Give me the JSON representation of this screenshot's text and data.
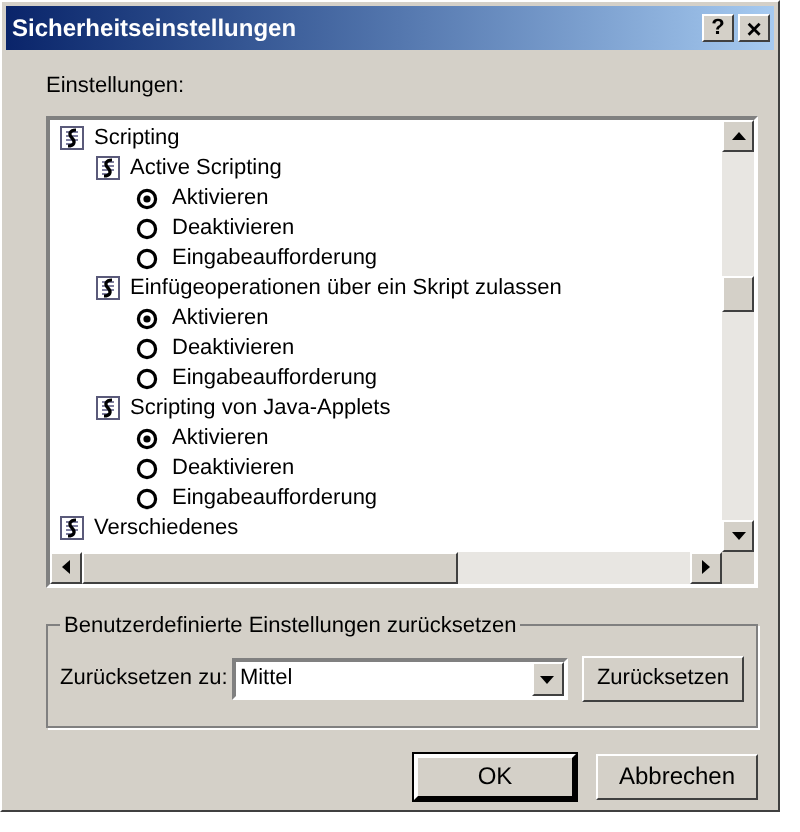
{
  "window": {
    "title": "Sicherheitseinstellungen",
    "help_button": "?",
    "close_button": "×"
  },
  "settings_label": "Einstellungen:",
  "tree": [
    {
      "label": "Scripting",
      "kind": "folder",
      "children": [
        {
          "label": "Active Scripting",
          "kind": "setting",
          "children": [
            {
              "label": "Aktivieren",
              "kind": "option",
              "selected": true
            },
            {
              "label": "Deaktivieren",
              "kind": "option",
              "selected": false
            },
            {
              "label": "Eingabeaufforderung",
              "kind": "option",
              "selected": false
            }
          ]
        },
        {
          "label": "Einfügeoperationen über ein Skript zulassen",
          "kind": "setting",
          "children": [
            {
              "label": "Aktivieren",
              "kind": "option",
              "selected": true
            },
            {
              "label": "Deaktivieren",
              "kind": "option",
              "selected": false
            },
            {
              "label": "Eingabeaufforderung",
              "kind": "option",
              "selected": false
            }
          ]
        },
        {
          "label": "Scripting von Java-Applets",
          "kind": "setting",
          "children": [
            {
              "label": "Aktivieren",
              "kind": "option",
              "selected": true
            },
            {
              "label": "Deaktivieren",
              "kind": "option",
              "selected": false
            },
            {
              "label": "Eingabeaufforderung",
              "kind": "option",
              "selected": false
            }
          ]
        }
      ]
    },
    {
      "label": "Verschiedenes",
      "kind": "folder"
    }
  ],
  "reset_group": {
    "title": "Benutzerdefinierte Einstellungen zurücksetzen",
    "label": "Zurücksetzen zu:",
    "value": "Mittel",
    "button": "Zurücksetzen"
  },
  "buttons": [
    {
      "label": "OK",
      "default": true
    },
    {
      "label": "Abbrechen",
      "default": false
    }
  ]
}
